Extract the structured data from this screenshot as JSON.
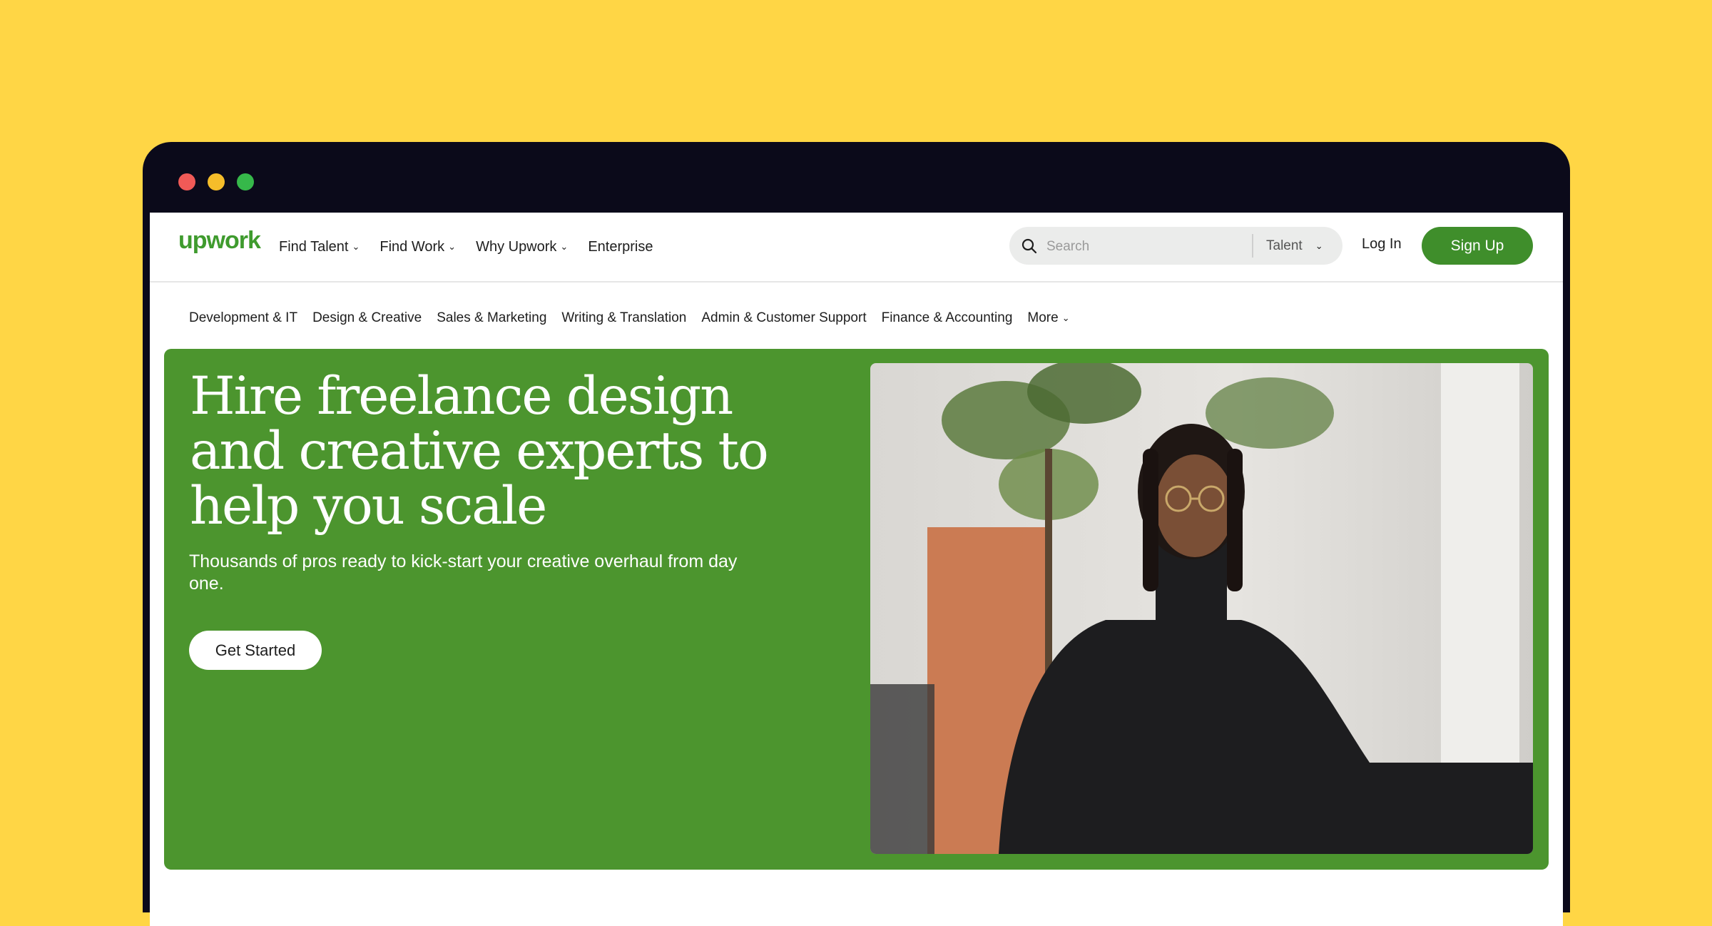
{
  "brand": {
    "logo_text": "upwork",
    "accent": "#3F8E2B",
    "hero_bg": "#4C952E",
    "page_bg": "#FFD645"
  },
  "window": {
    "controls": [
      "close-dot",
      "minimize-dot",
      "maximize-dot"
    ]
  },
  "nav": {
    "items": [
      {
        "label": "Find Talent",
        "dropdown": true
      },
      {
        "label": "Find Work",
        "dropdown": true
      },
      {
        "label": "Why Upwork",
        "dropdown": true
      },
      {
        "label": "Enterprise",
        "dropdown": false
      }
    ],
    "search": {
      "placeholder": "Search",
      "scope": "Talent"
    },
    "login": "Log In",
    "signup": "Sign Up"
  },
  "categories": [
    "Development & IT",
    "Design & Creative",
    "Sales & Marketing",
    "Writing & Translation",
    "Admin & Customer Support",
    "Finance & Accounting"
  ],
  "more_label": "More",
  "hero": {
    "title": "Hire freelance design and creative experts to help you scale",
    "subtitle": "Thousands of pros ready to kick-start your creative overhaul from day one.",
    "cta": "Get Started"
  }
}
